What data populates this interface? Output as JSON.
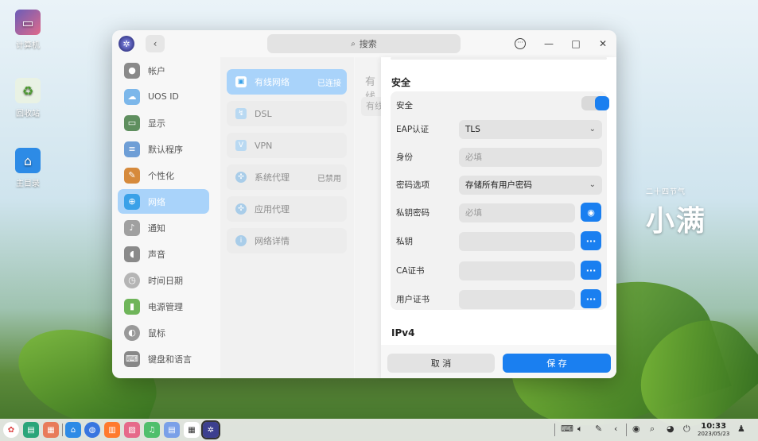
{
  "desktop": {
    "icons": [
      {
        "label": "计算机"
      },
      {
        "label": "回收站"
      },
      {
        "label": "主目录"
      }
    ],
    "solar_term": {
      "small": "二十四节气",
      "big": "小满"
    }
  },
  "window": {
    "search_placeholder": "搜索",
    "back_glyph": "‹",
    "menu_glyph": "···",
    "min_glyph": "—",
    "max_glyph": "□",
    "close_glyph": "✕"
  },
  "sidebar": {
    "items": [
      {
        "label": "帐户",
        "icon": "account-icon",
        "color": "#8a8a8a"
      },
      {
        "label": "UOS ID",
        "icon": "cloud-icon",
        "color": "#7cb7ea"
      },
      {
        "label": "显示",
        "icon": "display-icon",
        "color": "#5f8f5f"
      },
      {
        "label": "默认程序",
        "icon": "default-apps-icon",
        "color": "#6e9ed6"
      },
      {
        "label": "个性化",
        "icon": "personalization-icon",
        "color": "#d68a3c"
      },
      {
        "label": "网络",
        "icon": "network-icon",
        "color": "#3aa1e8",
        "active": true
      },
      {
        "label": "通知",
        "icon": "bell-icon",
        "color": "#a0a0a0"
      },
      {
        "label": "声音",
        "icon": "sound-icon",
        "color": "#8a8a8a"
      },
      {
        "label": "时间日期",
        "icon": "clock-icon",
        "color": "#b5b5b5"
      },
      {
        "label": "电源管理",
        "icon": "power-icon",
        "color": "#6fb55a"
      },
      {
        "label": "鼠标",
        "icon": "mouse-icon",
        "color": "#999999"
      },
      {
        "label": "键盘和语言",
        "icon": "keyboard-icon",
        "color": "#888888"
      }
    ]
  },
  "network_menu": {
    "items": [
      {
        "label": "有线网络",
        "status": "已连接",
        "icon": "wired-network-icon",
        "active": true
      },
      {
        "label": "DSL",
        "status": "",
        "icon": "dsl-icon"
      },
      {
        "label": "VPN",
        "status": "",
        "icon": "vpn-icon"
      },
      {
        "label": "系统代理",
        "status": "已禁用",
        "icon": "system-proxy-icon"
      },
      {
        "label": "应用代理",
        "status": "",
        "icon": "app-proxy-icon"
      },
      {
        "label": "网络详情",
        "status": "",
        "icon": "network-details-icon"
      }
    ]
  },
  "partial_column": {
    "title": "有线",
    "item": "有线"
  },
  "security": {
    "section_title": "安全",
    "toggle_label": "安全",
    "toggle_on": true,
    "eap_label": "EAP认证",
    "eap_value": "TLS",
    "identity_label": "身份",
    "identity_placeholder": "必填",
    "password_option_label": "密码选项",
    "password_option_value": "存储所有用户密码",
    "private_key_password_label": "私钥密码",
    "private_key_password_placeholder": "必填",
    "private_key_label": "私钥",
    "ca_cert_label": "CA证书",
    "user_cert_label": "用户证书",
    "browse_glyph": "···",
    "eye_glyph": "◉"
  },
  "ipv4": {
    "section_title": "IPv4"
  },
  "actions": {
    "cancel": "取 消",
    "save": "保 存"
  },
  "taskbar": {
    "time": "10:33",
    "date": "2023/05/23"
  },
  "colors": {
    "accent": "#1a7ff0",
    "active_bg": "#a9d3fa"
  }
}
